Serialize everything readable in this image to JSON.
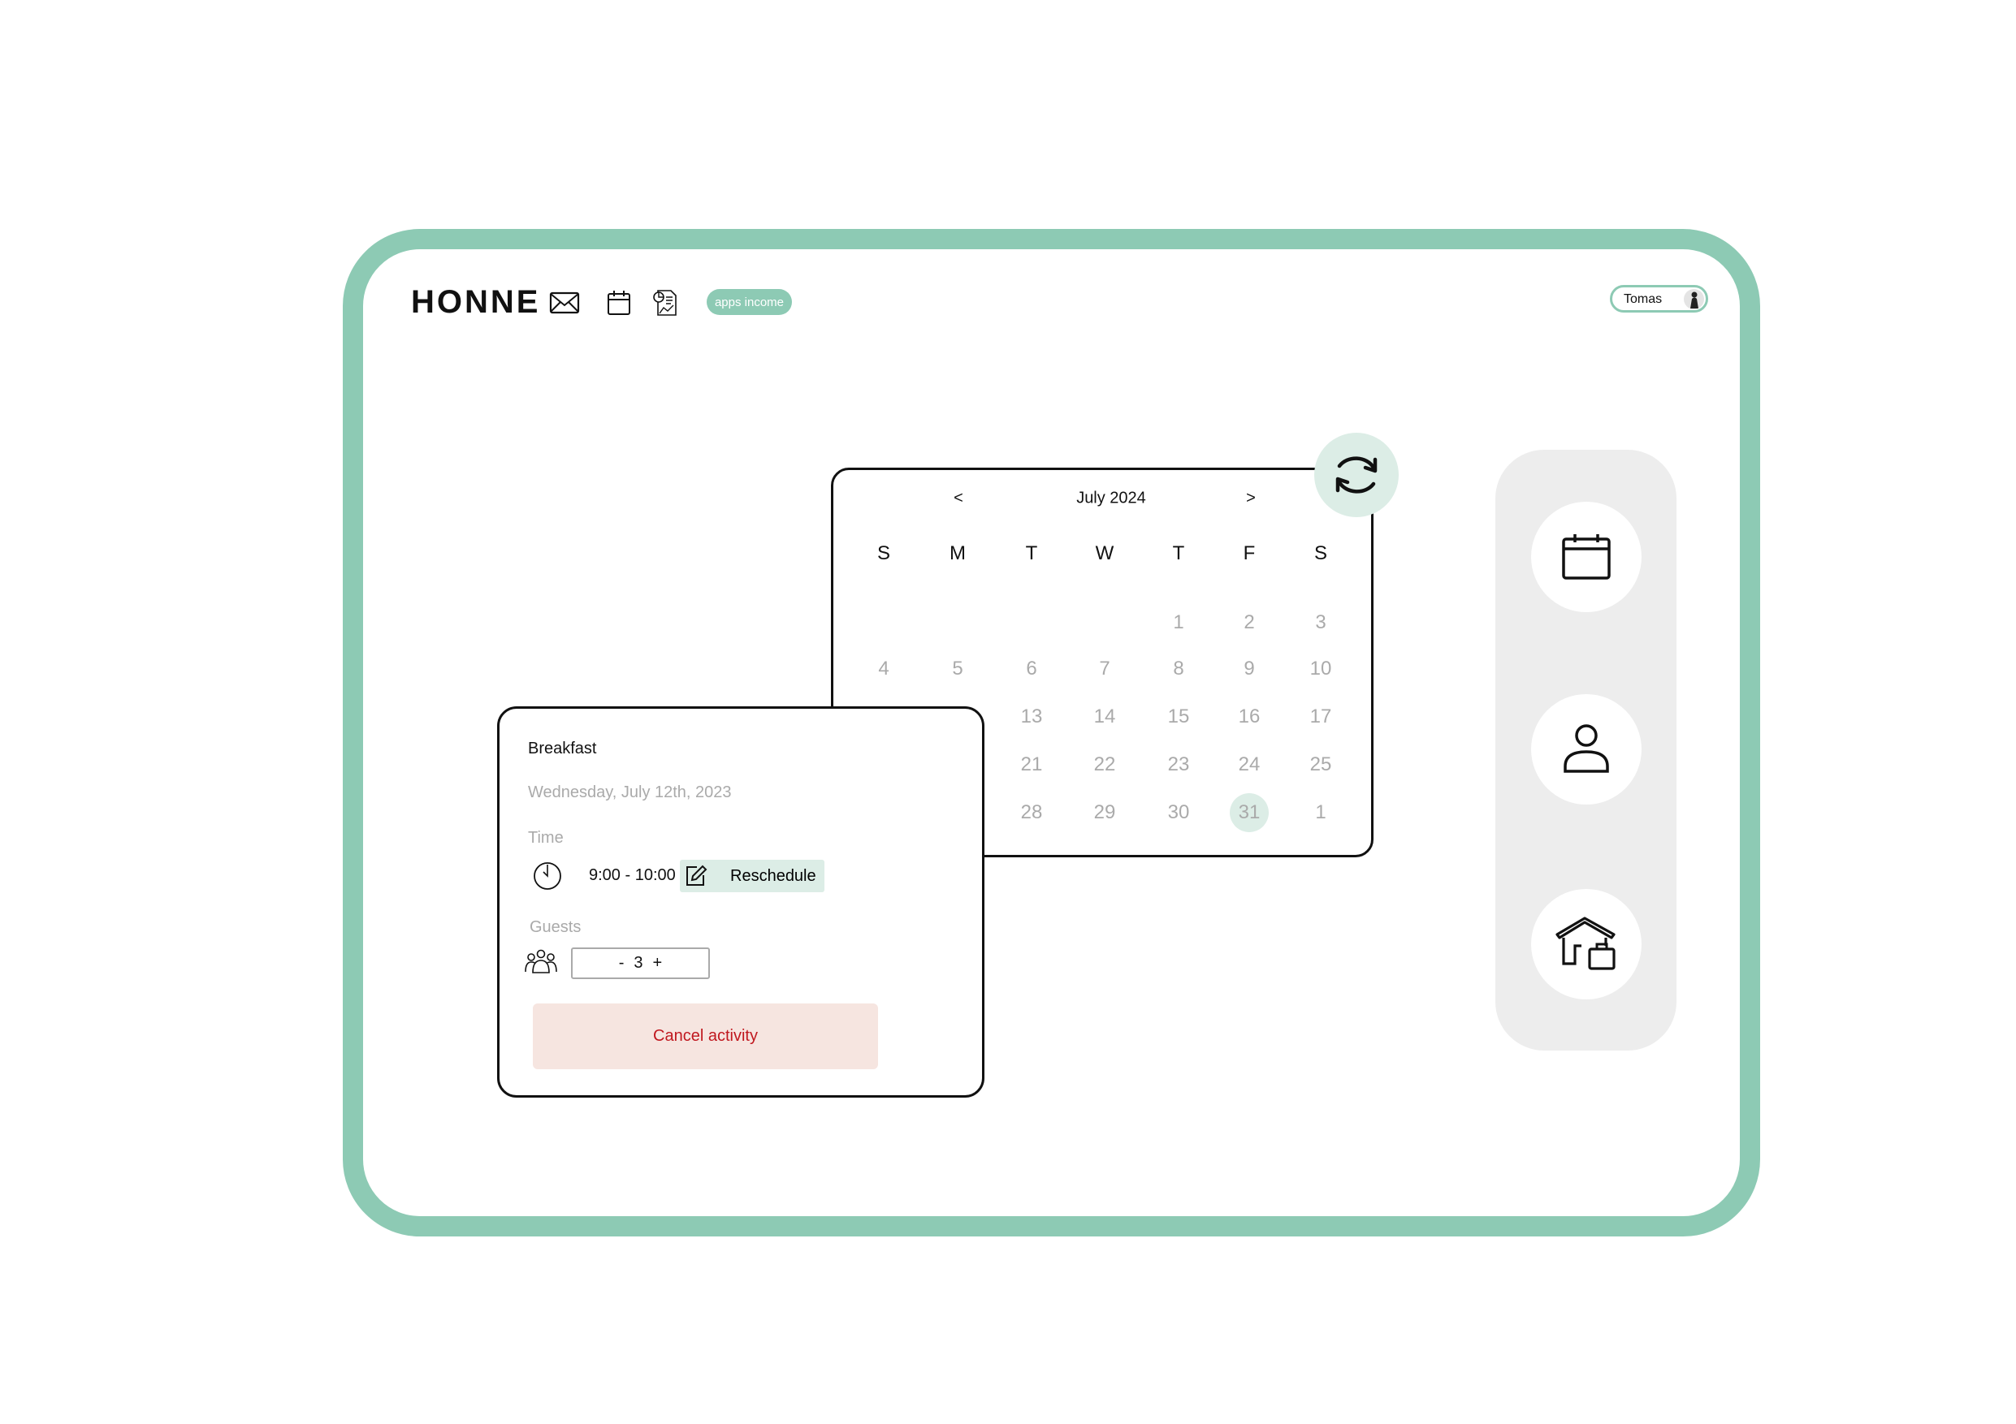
{
  "header": {
    "logo": "HONNE",
    "icons": [
      "mail-icon",
      "calendar-icon",
      "report-icon"
    ],
    "apps_income_label": "apps income",
    "user_name": "Tomas"
  },
  "calendar": {
    "month_label": "July 2024",
    "prev_label": "<",
    "next_label": ">",
    "weekdays": [
      "S",
      "M",
      "T",
      "W",
      "T",
      "F",
      "S"
    ],
    "weeks": [
      [
        "",
        "",
        "",
        "",
        "1",
        "2",
        "3"
      ],
      [
        "4",
        "5",
        "6",
        "7",
        "8",
        "9",
        "10"
      ],
      [
        "",
        "",
        "13",
        "14",
        "15",
        "16",
        "17"
      ],
      [
        "",
        "",
        "21",
        "22",
        "23",
        "24",
        "25"
      ],
      [
        "",
        "",
        "28",
        "29",
        "30",
        "31",
        "1"
      ]
    ],
    "selected_day": "31",
    "refresh_icon": "refresh-icon"
  },
  "event": {
    "title": "Breakfast",
    "date": "Wednesday, July 12th, 2023",
    "time_label": "Time",
    "time_value": "9:00 - 10:00",
    "reschedule_label": "Reschedule",
    "guests_label": "Guests",
    "guests_minus": "-",
    "guests_count": "3",
    "guests_plus": "+",
    "cancel_label": "Cancel activity"
  },
  "side_panel": {
    "icons": [
      "calendar-icon",
      "user-icon",
      "house-luggage-icon"
    ]
  },
  "colors": {
    "accent": "#8dcab4",
    "accent_light": "#dcede6",
    "cancel_bg": "#f6e5e0",
    "cancel_text": "#c0181f",
    "panel_bg": "#ededed",
    "muted_text": "#aaaaaa"
  }
}
